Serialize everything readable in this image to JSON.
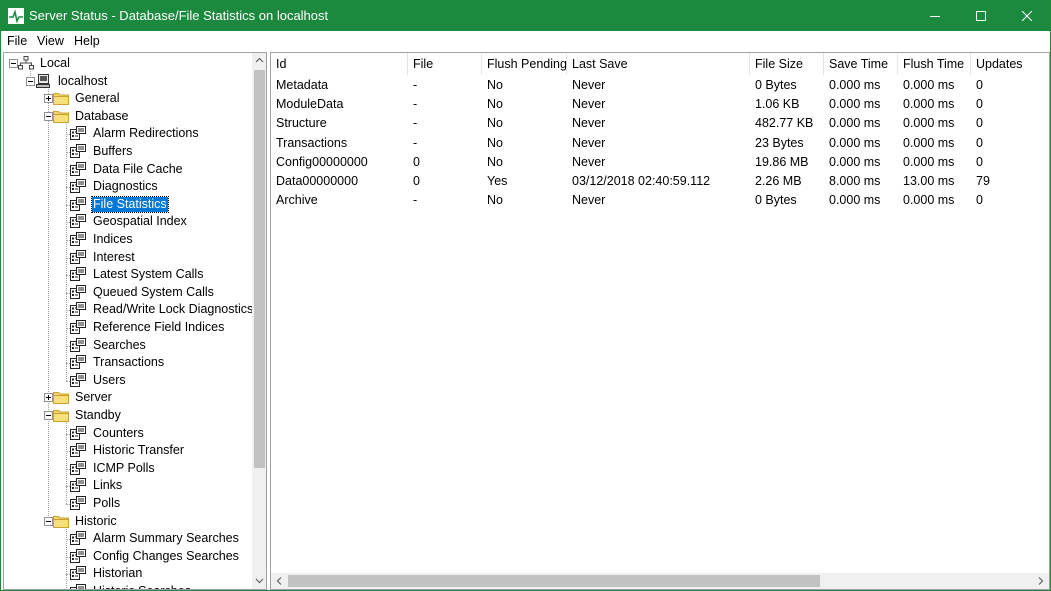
{
  "window": {
    "title": "Server Status - Database/File Statistics on localhost",
    "accent_color": "#1b8a3e"
  },
  "menu": [
    "File",
    "View",
    "Help"
  ],
  "tree": {
    "items": [
      {
        "label": "Local",
        "icon": "network-icon",
        "level": 0,
        "expander": "minus"
      },
      {
        "label": "localhost",
        "icon": "server-icon",
        "level": 1,
        "expander": "minus"
      },
      {
        "label": "General",
        "icon": "folder-icon",
        "level": 2,
        "expander": "plus"
      },
      {
        "label": "Database",
        "icon": "folder-icon",
        "level": 2,
        "expander": "minus"
      },
      {
        "label": "Alarm Redirections",
        "icon": "stats-icon",
        "level": 3
      },
      {
        "label": "Buffers",
        "icon": "stats-icon",
        "level": 3
      },
      {
        "label": "Data File Cache",
        "icon": "stats-icon",
        "level": 3
      },
      {
        "label": "Diagnostics",
        "icon": "stats-icon",
        "level": 3
      },
      {
        "label": "File Statistics",
        "icon": "stats-icon",
        "level": 3,
        "selected": true
      },
      {
        "label": "Geospatial Index",
        "icon": "stats-icon",
        "level": 3
      },
      {
        "label": "Indices",
        "icon": "stats-icon",
        "level": 3
      },
      {
        "label": "Interest",
        "icon": "stats-icon",
        "level": 3
      },
      {
        "label": "Latest System Calls",
        "icon": "stats-icon",
        "level": 3
      },
      {
        "label": "Queued System Calls",
        "icon": "stats-icon",
        "level": 3
      },
      {
        "label": "Read/Write Lock Diagnostics",
        "icon": "stats-icon",
        "level": 3
      },
      {
        "label": "Reference Field Indices",
        "icon": "stats-icon",
        "level": 3
      },
      {
        "label": "Searches",
        "icon": "stats-icon",
        "level": 3
      },
      {
        "label": "Transactions",
        "icon": "stats-icon",
        "level": 3
      },
      {
        "label": "Users",
        "icon": "stats-icon",
        "level": 3
      },
      {
        "label": "Server",
        "icon": "folder-icon",
        "level": 2,
        "expander": "plus"
      },
      {
        "label": "Standby",
        "icon": "folder-icon",
        "level": 2,
        "expander": "minus"
      },
      {
        "label": "Counters",
        "icon": "stats-icon",
        "level": 3
      },
      {
        "label": "Historic Transfer",
        "icon": "stats-icon",
        "level": 3
      },
      {
        "label": "ICMP Polls",
        "icon": "stats-icon",
        "level": 3
      },
      {
        "label": "Links",
        "icon": "stats-icon",
        "level": 3
      },
      {
        "label": "Polls",
        "icon": "stats-icon",
        "level": 3
      },
      {
        "label": "Historic",
        "icon": "folder-icon",
        "level": 2,
        "expander": "minus"
      },
      {
        "label": "Alarm Summary Searches",
        "icon": "stats-icon",
        "level": 3
      },
      {
        "label": "Config Changes Searches",
        "icon": "stats-icon",
        "level": 3
      },
      {
        "label": "Historian",
        "icon": "stats-icon",
        "level": 3
      },
      {
        "label": "Historic Searches",
        "icon": "stats-icon",
        "level": 3
      }
    ]
  },
  "table": {
    "columns": [
      "Id",
      "File",
      "Flush Pending",
      "Last Save",
      "File Size",
      "Save Time",
      "Flush Time",
      "Updates"
    ],
    "rows": [
      [
        "Metadata",
        "-",
        "No",
        "Never",
        "0 Bytes",
        "0.000 ms",
        "0.000 ms",
        "0"
      ],
      [
        "ModuleData",
        "-",
        "No",
        "Never",
        "1.06 KB",
        "0.000 ms",
        "0.000 ms",
        "0"
      ],
      [
        "Structure",
        "-",
        "No",
        "Never",
        "482.77 KB",
        "0.000 ms",
        "0.000 ms",
        "0"
      ],
      [
        "Transactions",
        "-",
        "No",
        "Never",
        "23 Bytes",
        "0.000 ms",
        "0.000 ms",
        "0"
      ],
      [
        "Config00000000",
        "0",
        "No",
        "Never",
        "19.86 MB",
        "0.000 ms",
        "0.000 ms",
        "0"
      ],
      [
        "Data00000000",
        "0",
        "Yes",
        "03/12/2018 02:40:59.112",
        "2.26 MB",
        "8.000 ms",
        "13.00 ms",
        "79"
      ],
      [
        "Archive",
        "-",
        "No",
        "Never",
        "0 Bytes",
        "0.000 ms",
        "0.000 ms",
        "0"
      ]
    ]
  }
}
